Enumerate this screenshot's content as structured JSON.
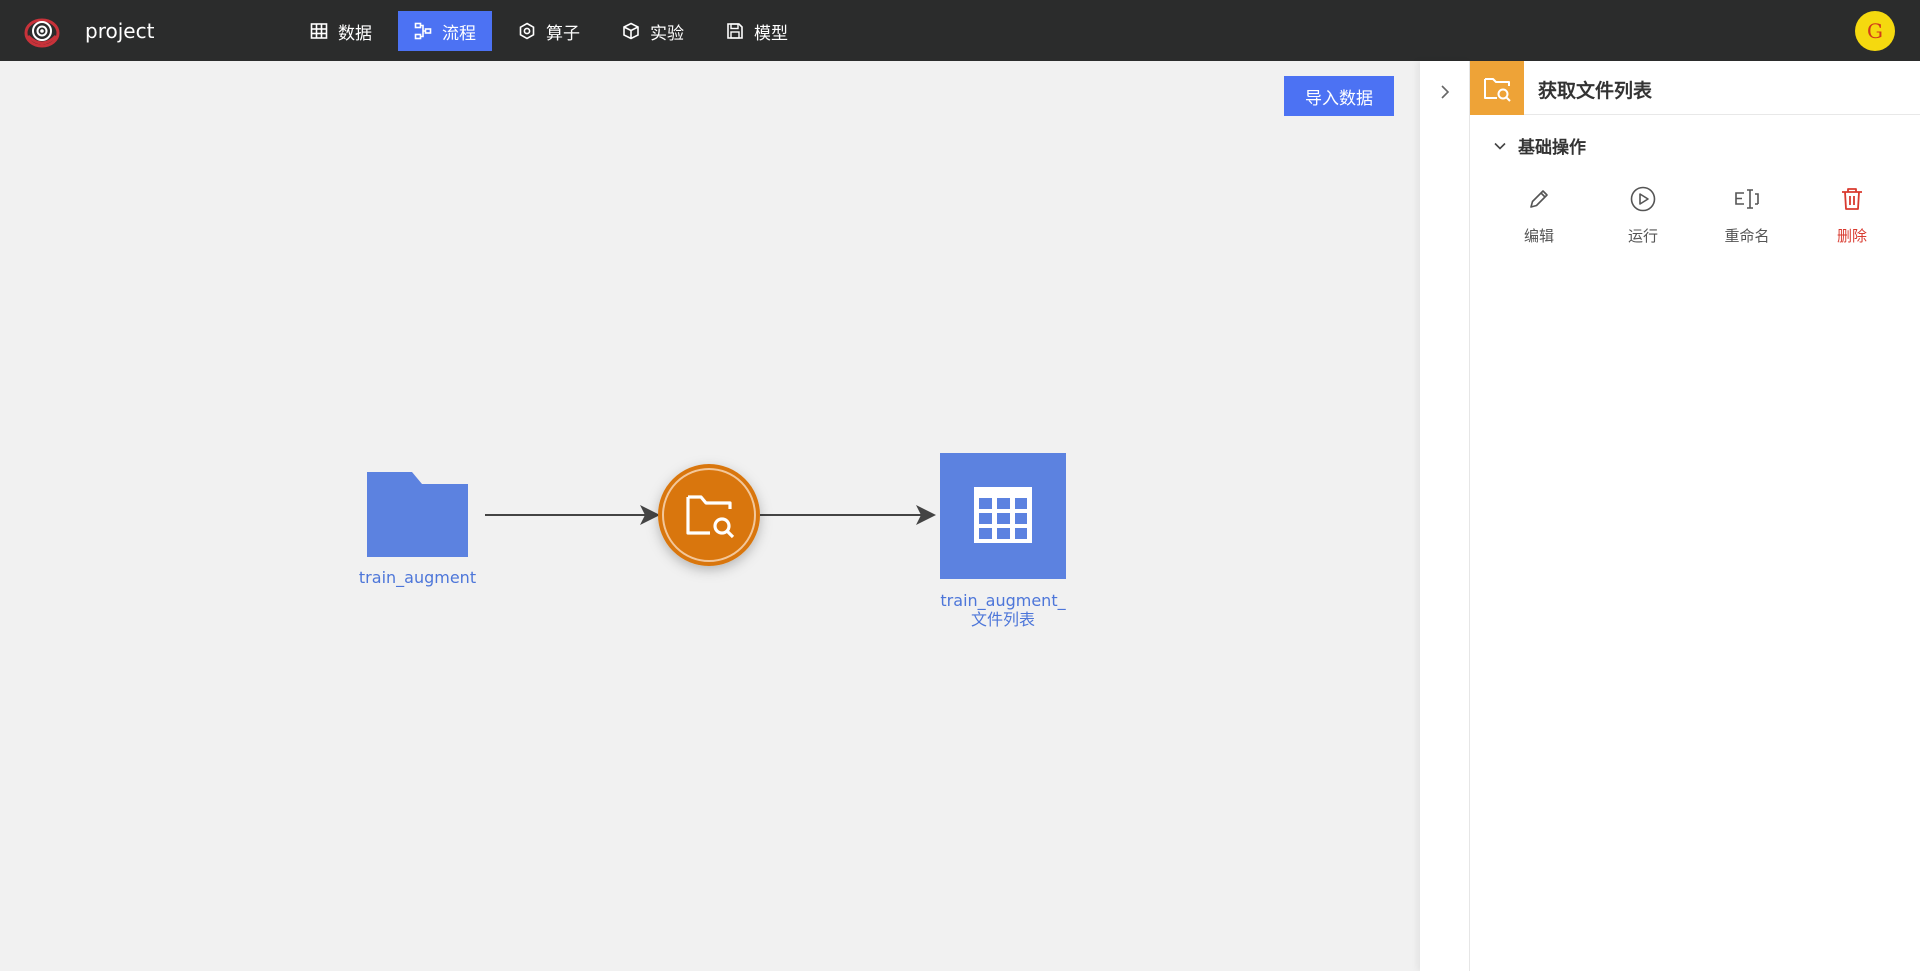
{
  "app": {
    "project_name": "project",
    "avatar_letter": "G"
  },
  "nav": {
    "items": [
      {
        "label": "数据",
        "icon": "table-icon"
      },
      {
        "label": "流程",
        "icon": "flow-icon",
        "active": true
      },
      {
        "label": "算子",
        "icon": "hexagon-icon"
      },
      {
        "label": "实验",
        "icon": "cube-icon"
      },
      {
        "label": "模型",
        "icon": "save-icon"
      }
    ]
  },
  "canvas": {
    "import_label": "导入数据",
    "nodes": {
      "source": {
        "label": "train_augment",
        "icon": "folder-icon"
      },
      "operator": {
        "icon": "folder-search-icon"
      },
      "output": {
        "label_line1": "train_augment_",
        "label_line2": "文件列表",
        "icon": "table-grid-icon"
      }
    }
  },
  "panel": {
    "title": "获取文件列表",
    "section_title": "基础操作",
    "actions": {
      "edit": "编辑",
      "run": "运行",
      "rename": "重命名",
      "delete": "删除"
    }
  },
  "colors": {
    "accent": "#4c72f3",
    "node_blue": "#5c82e0",
    "operator_orange": "#d9760a",
    "panel_icon_bg": "#eea337",
    "danger": "#d93a2f"
  }
}
